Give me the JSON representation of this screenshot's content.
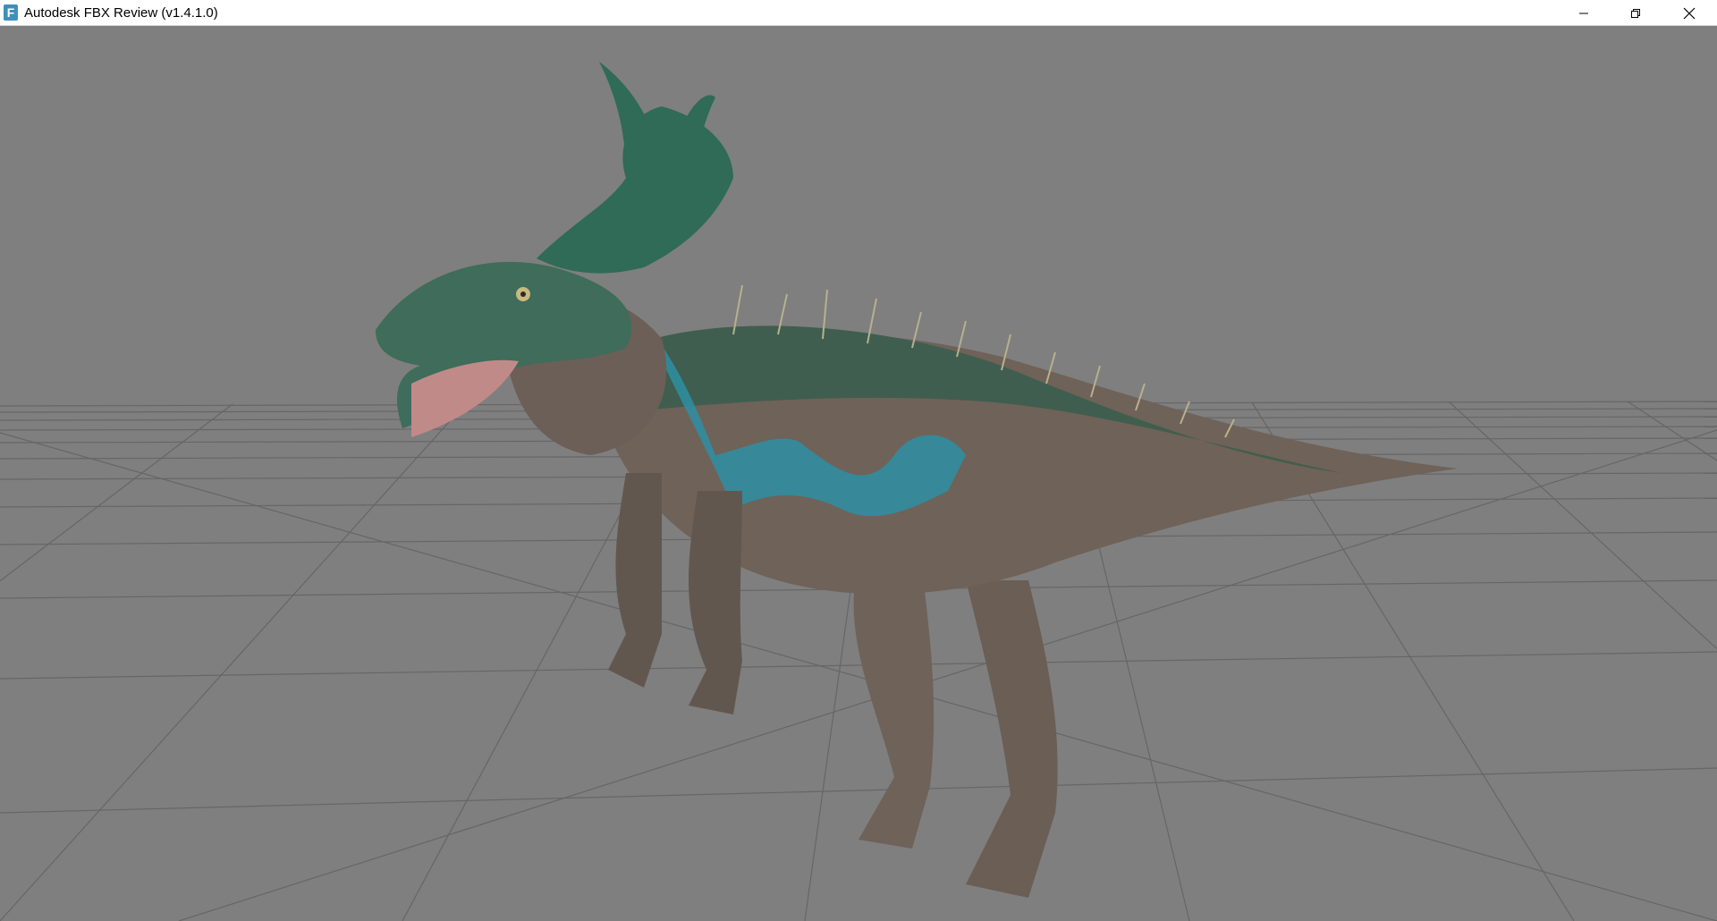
{
  "window": {
    "title": "Autodesk FBX Review (v1.4.1.0)",
    "app_icon_letter": "F",
    "controls": [
      "minimize",
      "restore",
      "close"
    ]
  },
  "viewport": {
    "background_color": "#7f7f7f",
    "grid_color": "#5e5e5e",
    "model": "green-teal dinosaur creature with antler horns"
  }
}
